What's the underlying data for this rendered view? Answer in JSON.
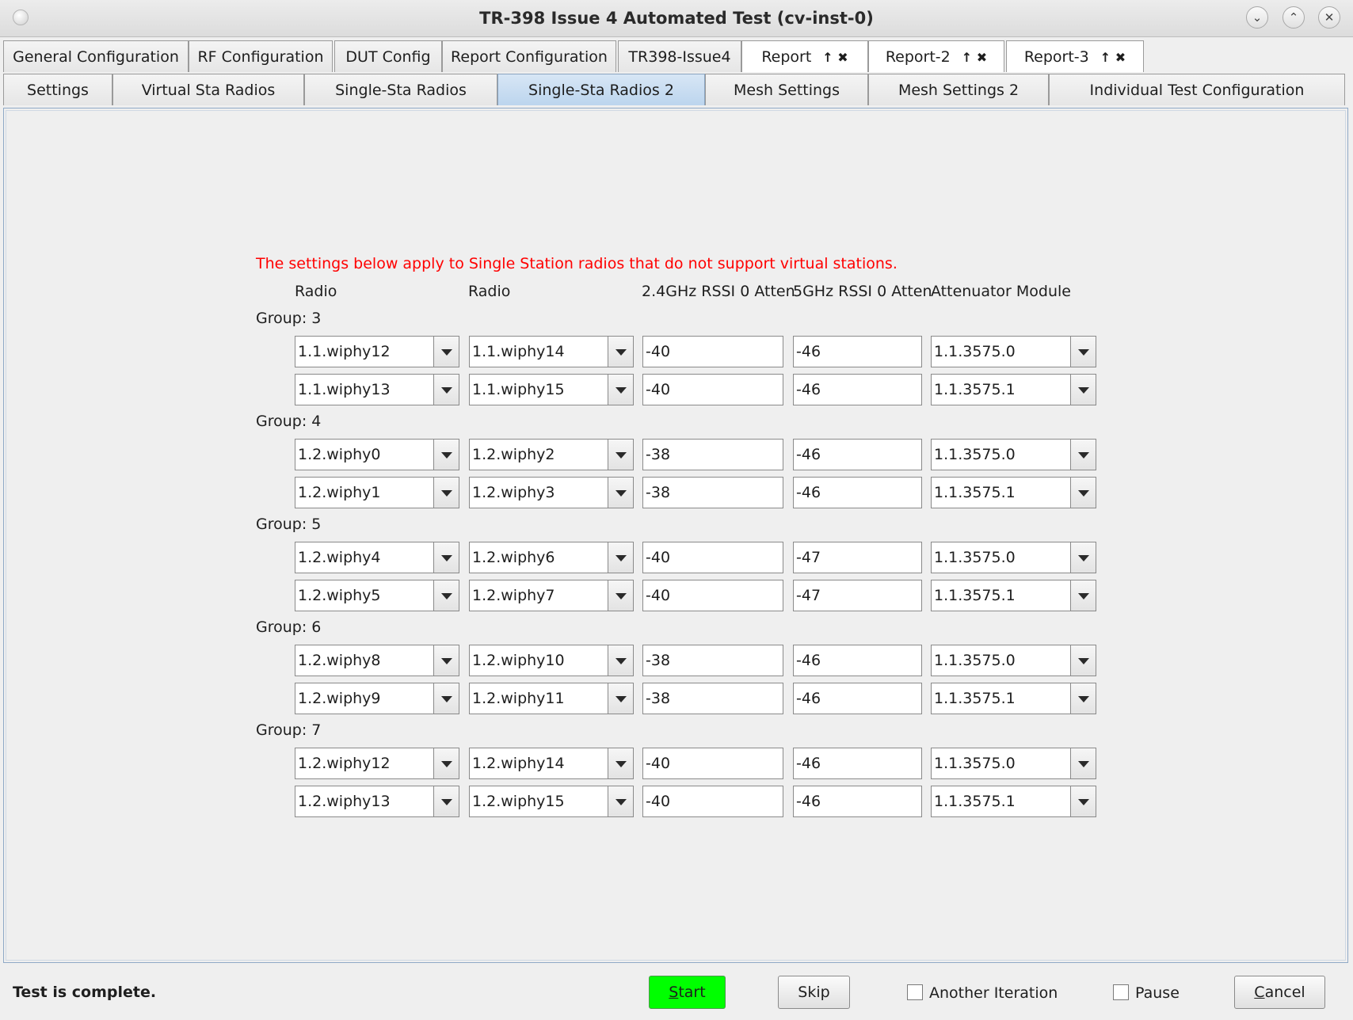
{
  "window": {
    "title": "TR-398 Issue 4 Automated Test  (cv-inst-0)",
    "controls": [
      "⌄",
      "⌃",
      "✕"
    ]
  },
  "tabs_row1": [
    {
      "label": "General Configuration"
    },
    {
      "label": "RF Configuration"
    },
    {
      "label": "DUT Config"
    },
    {
      "label": "Report Configuration"
    },
    {
      "label": "TR398-Issue4"
    },
    {
      "label": "Report",
      "icons": "↑ ✖"
    },
    {
      "label": "Report-2",
      "icons": "↑ ✖"
    },
    {
      "label": "Report-3",
      "icons": "↑ ✖"
    }
  ],
  "tabs_row2": [
    {
      "label": "Settings"
    },
    {
      "label": "Virtual Sta Radios"
    },
    {
      "label": "Single-Sta Radios"
    },
    {
      "label": "Single-Sta Radios 2",
      "selected": true
    },
    {
      "label": "Mesh Settings"
    },
    {
      "label": "Mesh Settings 2"
    },
    {
      "label": "Individual Test Configuration"
    }
  ],
  "notice": "The settings below apply to Single Station radios that do not support virtual stations.",
  "notice_color": "#ff0000",
  "columns": [
    "Radio",
    "Radio",
    "2.4GHz RSSI 0 Atten",
    "5GHz RSSI 0 Atten",
    "Attenuator Module"
  ],
  "groups": [
    {
      "label": "Group: 3",
      "rows": [
        {
          "radio1": "1.1.wiphy12",
          "radio2": "1.1.wiphy14",
          "rssi24": "-40",
          "rssi5": "-46",
          "atten": "1.1.3575.0"
        },
        {
          "radio1": "1.1.wiphy13",
          "radio2": "1.1.wiphy15",
          "rssi24": "-40",
          "rssi5": "-46",
          "atten": "1.1.3575.1"
        }
      ]
    },
    {
      "label": "Group: 4",
      "rows": [
        {
          "radio1": "1.2.wiphy0",
          "radio2": "1.2.wiphy2",
          "rssi24": "-38",
          "rssi5": "-46",
          "atten": "1.1.3575.0"
        },
        {
          "radio1": "1.2.wiphy1",
          "radio2": "1.2.wiphy3",
          "rssi24": "-38",
          "rssi5": "-46",
          "atten": "1.1.3575.1"
        }
      ]
    },
    {
      "label": "Group: 5",
      "rows": [
        {
          "radio1": "1.2.wiphy4",
          "radio2": "1.2.wiphy6",
          "rssi24": "-40",
          "rssi5": "-47",
          "atten": "1.1.3575.0"
        },
        {
          "radio1": "1.2.wiphy5",
          "radio2": "1.2.wiphy7",
          "rssi24": "-40",
          "rssi5": "-47",
          "atten": "1.1.3575.1"
        }
      ]
    },
    {
      "label": "Group: 6",
      "rows": [
        {
          "radio1": "1.2.wiphy8",
          "radio2": "1.2.wiphy10",
          "rssi24": "-38",
          "rssi5": "-46",
          "atten": "1.1.3575.0"
        },
        {
          "radio1": "1.2.wiphy9",
          "radio2": "1.2.wiphy11",
          "rssi24": "-38",
          "rssi5": "-46",
          "atten": "1.1.3575.1"
        }
      ]
    },
    {
      "label": "Group: 7",
      "rows": [
        {
          "radio1": "1.2.wiphy12",
          "radio2": "1.2.wiphy14",
          "rssi24": "-40",
          "rssi5": "-46",
          "atten": "1.1.3575.0"
        },
        {
          "radio1": "1.2.wiphy13",
          "radio2": "1.2.wiphy15",
          "rssi24": "-40",
          "rssi5": "-46",
          "atten": "1.1.3575.1"
        }
      ]
    }
  ],
  "footer": {
    "status": "Test is complete.",
    "start": {
      "mnemonic": "S",
      "rest": "tart",
      "color": "#00ff00"
    },
    "skip": "Skip",
    "another_iteration": "Another Iteration",
    "pause": "Pause",
    "cancel": {
      "mnemonic": "C",
      "rest": "ancel"
    }
  }
}
